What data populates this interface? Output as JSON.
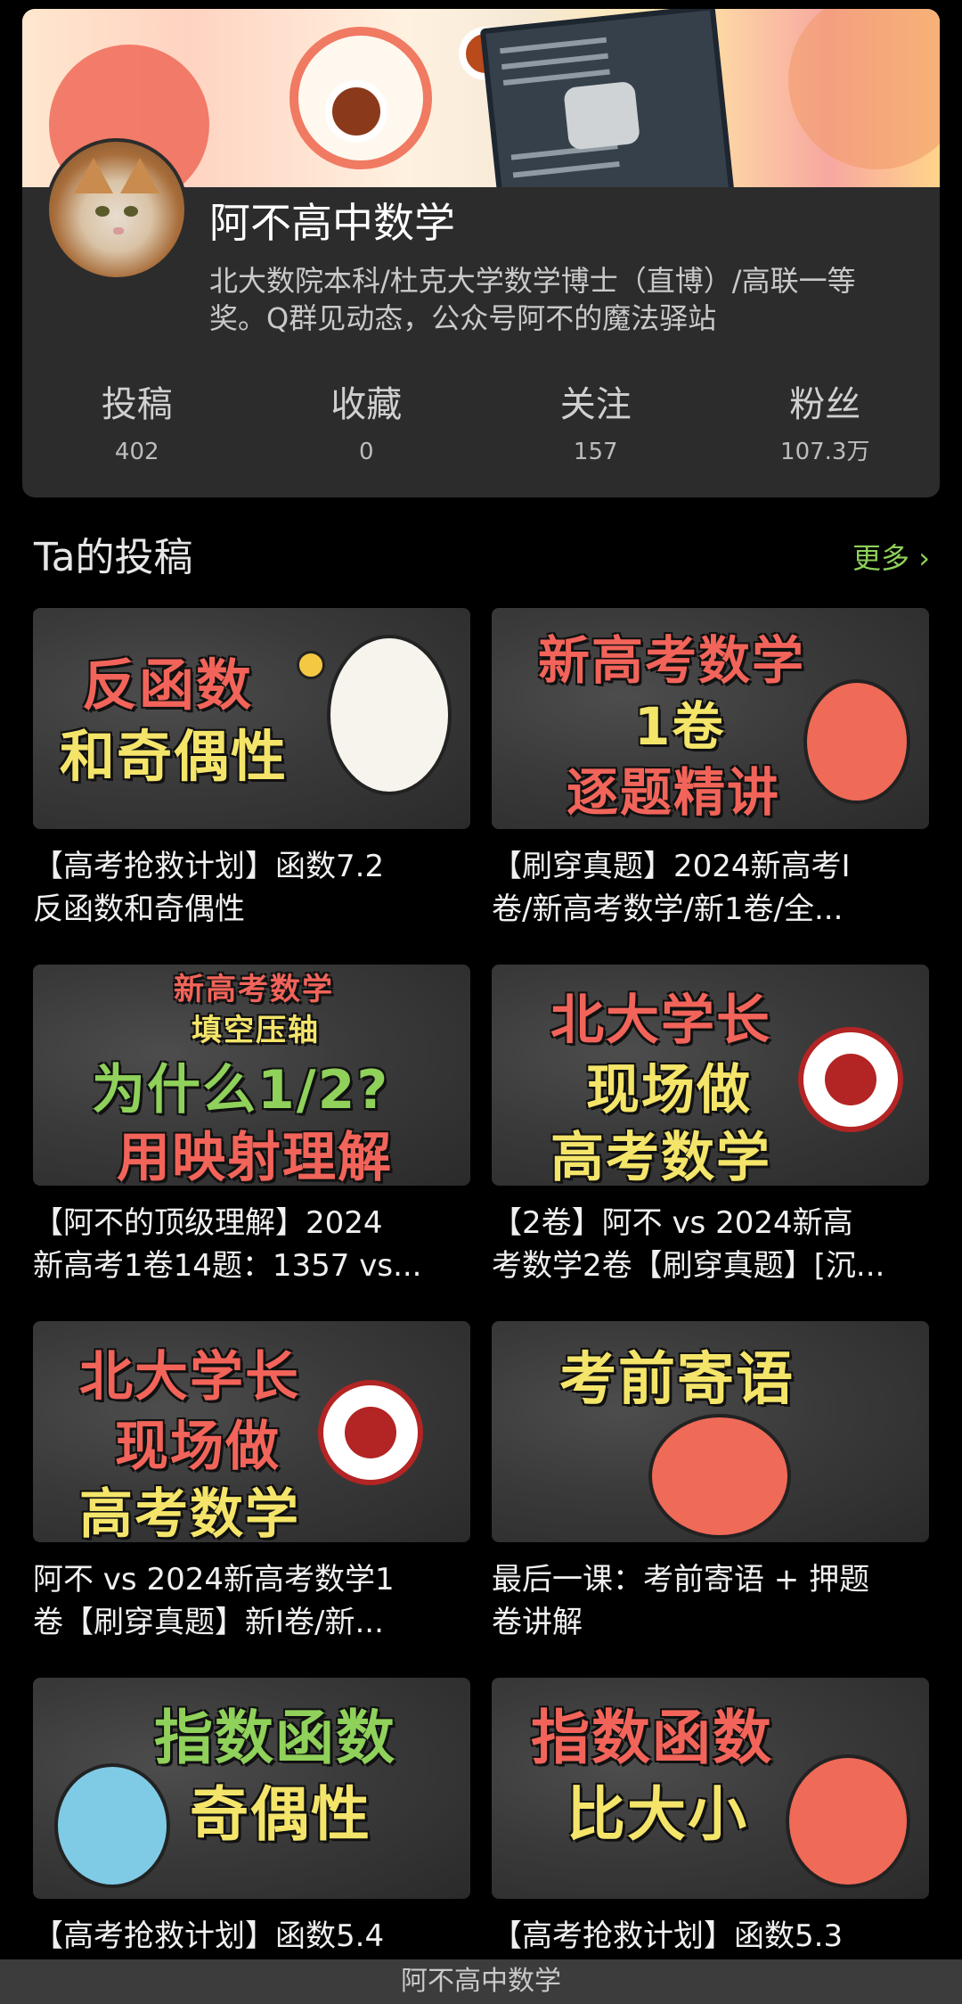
{
  "profile": {
    "name": "阿不高中数学",
    "bio_line1": "北大数院本科/杜克大学数学博士（直博）/高联一等",
    "bio_line2": "奖。Q群见动态，公众号阿不的魔法驿站",
    "stats": [
      {
        "label": "投稿",
        "value": "402"
      },
      {
        "label": "收藏",
        "value": "0"
      },
      {
        "label": "关注",
        "value": "157"
      },
      {
        "label": "粉丝",
        "value": "107.3万"
      }
    ]
  },
  "section": {
    "title": "Ta的投稿",
    "more": "更多 ›"
  },
  "videos": [
    {
      "thumb_lines": [
        "反函数",
        "和奇偶性"
      ],
      "title_line1": "【高考抢救计划】函数7.2",
      "title_line2": "反函数和奇偶性"
    },
    {
      "thumb_lines": [
        "新高考数学",
        "1卷",
        "逐题精讲"
      ],
      "title_line1": "【刷穿真题】2024新高考I",
      "title_line2": "卷/新高考数学/新1卷/全..."
    },
    {
      "thumb_lines": [
        "新高考数学",
        "填空压轴",
        "为什么1/2?",
        "用映射理解"
      ],
      "title_line1": "【阿不的顶级理解】2024",
      "title_line2": "新高考1卷14题：1357 vs..."
    },
    {
      "thumb_lines": [
        "北大学长",
        "现场做",
        "高考数学"
      ],
      "title_line1": "【2卷】阿不 vs 2024新高",
      "title_line2": "考数学2卷【刷穿真题】[沉..."
    },
    {
      "thumb_lines": [
        "北大学长",
        "现场做",
        "高考数学"
      ],
      "title_line1": "阿不 vs 2024新高考数学1",
      "title_line2": "卷【刷穿真题】新I卷/新..."
    },
    {
      "thumb_lines": [
        "考前寄语"
      ],
      "title_line1": "最后一课：考前寄语 + 押题",
      "title_line2": "卷讲解"
    },
    {
      "thumb_lines": [
        "指数函数",
        "奇偶性"
      ],
      "title_line1": "【高考抢救计划】函数5.4",
      "title_line2": ""
    },
    {
      "thumb_lines": [
        "指数函数",
        "比大小"
      ],
      "title_line1": "【高考抢救计划】函数5.3",
      "title_line2": ""
    }
  ],
  "bottom_bar": {
    "title": "阿不高中数学"
  },
  "colors": {
    "accent_green": "#8ed15a",
    "thumb_red": "#f2645a",
    "thumb_yellow": "#f4e56a",
    "card_bg": "#2c2c2c"
  },
  "icons": {
    "more": "chevron-right-icon",
    "emblem": "peking-university-emblem"
  }
}
